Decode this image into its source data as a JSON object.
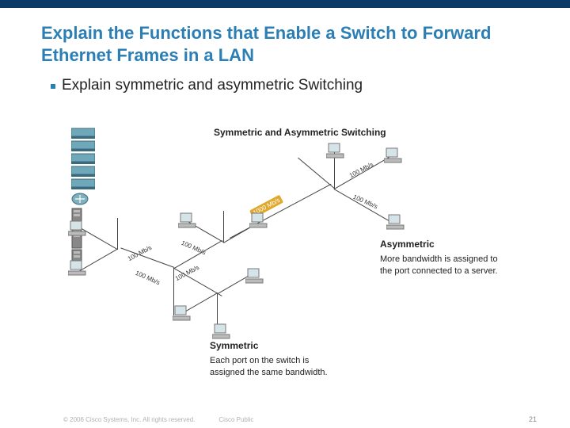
{
  "header": {
    "title": "Explain the Functions that Enable a Switch to Forward Ethernet Frames in a LAN"
  },
  "bullet": {
    "text": "Explain symmetric and asymmetric Switching"
  },
  "diagram": {
    "title": "Symmetric and Asymmetric Switching",
    "links": {
      "l100_1": "100 Mb/s",
      "l100_2": "100 Mb/s",
      "l100_3": "100 Mb/s",
      "l100_4": "100 Mb/s",
      "l100_5": "100 Mb/s",
      "l100_6": "100 Mb/s",
      "l1000": "1000 Mb/s"
    },
    "symmetric": {
      "heading": "Symmetric",
      "body": "Each port on the switch is assigned the same bandwidth."
    },
    "asymmetric": {
      "heading": "Asymmetric",
      "body": "More bandwidth is assigned to the port connected to a server."
    }
  },
  "footer": {
    "copyright": "© 2006 Cisco Systems, Inc. All rights reserved.",
    "label": "Cisco Public",
    "page": "21"
  }
}
